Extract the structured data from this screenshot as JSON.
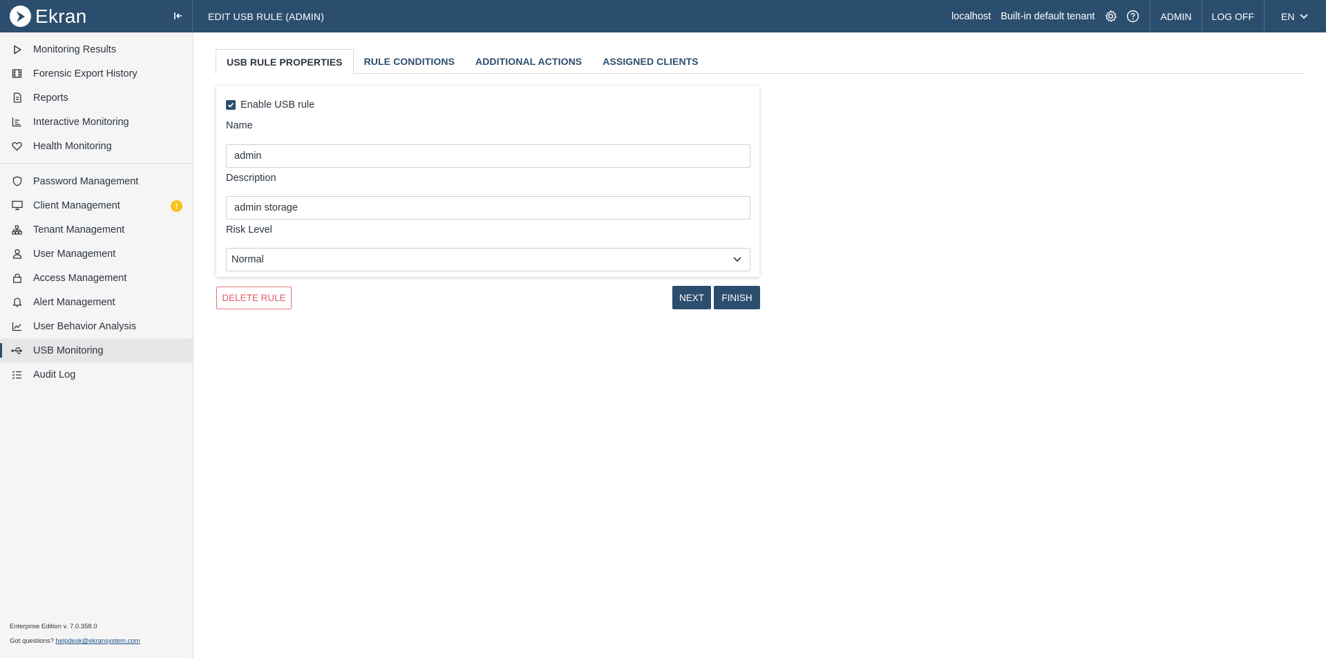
{
  "app": {
    "brand": "Ekran",
    "page_title": "EDIT USB RULE (ADMIN)"
  },
  "topbar": {
    "host": "localhost",
    "tenant": "Built-in default tenant",
    "user": "ADMIN",
    "logoff": "LOG OFF",
    "language": "EN",
    "settings_icon": "gear-icon",
    "help_icon": "help-circle-icon"
  },
  "sidebar": {
    "group1": [
      {
        "label": "Monitoring Results",
        "icon": "play-icon"
      },
      {
        "label": "Forensic Export History",
        "icon": "film-icon"
      },
      {
        "label": "Reports",
        "icon": "document-icon"
      },
      {
        "label": "Interactive Monitoring",
        "icon": "bar-chart-icon"
      },
      {
        "label": "Health Monitoring",
        "icon": "heart-icon"
      }
    ],
    "group2": [
      {
        "label": "Password Management",
        "icon": "shield-icon"
      },
      {
        "label": "Client Management",
        "icon": "monitor-icon",
        "badge": "!"
      },
      {
        "label": "Tenant Management",
        "icon": "hierarchy-icon"
      },
      {
        "label": "User Management",
        "icon": "user-icon"
      },
      {
        "label": "Access Management",
        "icon": "lock-icon"
      },
      {
        "label": "Alert Management",
        "icon": "bell-icon"
      },
      {
        "label": "User Behavior Analysis",
        "icon": "line-chart-icon"
      },
      {
        "label": "USB Monitoring",
        "icon": "usb-icon",
        "active": true
      },
      {
        "label": "Audit Log",
        "icon": "checklist-icon"
      }
    ],
    "footer": {
      "edition": "Enterprise Edition v. 7.0.358.0",
      "questions": "Got questions?",
      "email": "helpdesk@ekransystem.com"
    }
  },
  "tabs": [
    {
      "label": "USB RULE PROPERTIES",
      "active": true
    },
    {
      "label": "RULE CONDITIONS"
    },
    {
      "label": "ADDITIONAL ACTIONS"
    },
    {
      "label": "ASSIGNED CLIENTS"
    }
  ],
  "form": {
    "enable_label": "Enable USB rule",
    "enabled": true,
    "name_label": "Name",
    "name_value": "admin",
    "description_label": "Description",
    "description_value": "admin storage",
    "risk_label": "Risk Level",
    "risk_value": "Normal"
  },
  "actions": {
    "delete": "DELETE RULE",
    "next": "NEXT",
    "finish": "FINISH"
  },
  "colors": {
    "header": "#2c4e6e",
    "badge": "#f7c21b",
    "danger": "#e45b67"
  }
}
